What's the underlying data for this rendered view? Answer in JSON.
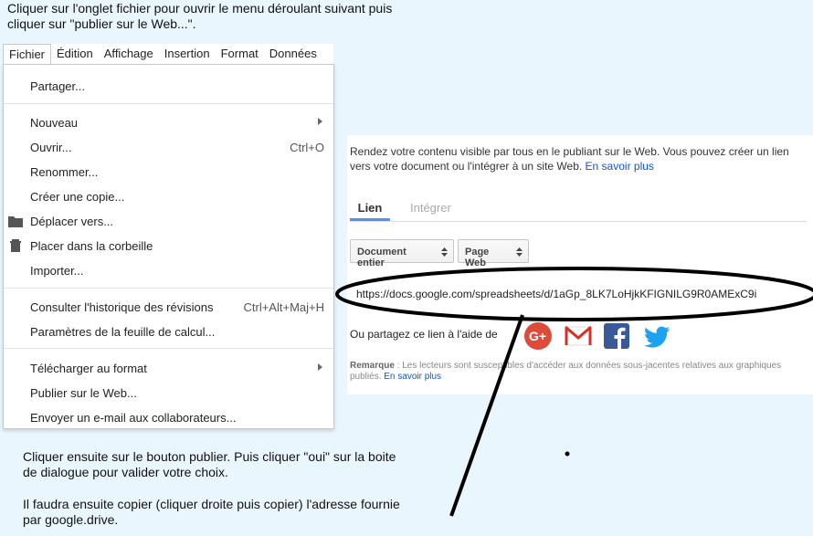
{
  "instructions": {
    "top_line1": "Cliquer sur l'onglet fichier pour ouvrir le menu déroulant suivant puis",
    "top_line2": "cliquer sur \"publier sur le Web...\".",
    "bottom_p1_line1": "Cliquer ensuite sur le bouton publier. Puis cliquer \"oui\" sur la boite",
    "bottom_p1_line2": "de dialogue pour valider votre choix.",
    "bottom_p2_line1": "Il faudra ensuite copier (cliquer droite puis copier) l'adresse fournie",
    "bottom_p2_line2": "par google.drive."
  },
  "menubar": [
    "Fichier",
    "Édition",
    "Affichage",
    "Insertion",
    "Format",
    "Données"
  ],
  "file_menu": {
    "share": "Partager...",
    "new": "Nouveau",
    "open": "Ouvrir...",
    "open_shortcut": "Ctrl+O",
    "rename": "Renommer...",
    "copy": "Créer une copie...",
    "move": "Déplacer vers...",
    "trash": "Placer dans la corbeille",
    "import": "Importer...",
    "history": "Consulter l'historique des révisions",
    "history_shortcut": "Ctrl+Alt+Maj+H",
    "settings": "Paramètres de la feuille de calcul...",
    "download": "Télécharger au format",
    "publish": "Publier sur le Web...",
    "email": "Envoyer un e-mail aux collaborateurs..."
  },
  "publish_panel": {
    "description": "Rendez votre contenu visible par tous en le publiant sur le Web. Vous pouvez créer un lien vers votre document ou l'intégrer à un site Web.",
    "learn_more": "En savoir plus",
    "tab_link": "Lien",
    "tab_embed": "Intégrer",
    "select_document": "Document entier",
    "select_format": "Page Web",
    "url": "https://docs.google.com/spreadsheets/d/1aGp_8LK7LoHjkKFIGNILG9R0AMExC9i",
    "share_label": "Ou partagez ce lien à l'aide de",
    "note_label": "Remarque",
    "note_text": " : Les lecteurs sont susceptibles d'accéder aux données sous-jacentes relatives aux graphiques publiés.",
    "note_learn_more": "En savoir plus"
  },
  "social_icons": [
    "google-plus-icon",
    "gmail-icon",
    "facebook-icon",
    "twitter-icon"
  ],
  "colors": {
    "background": "#eaf6fd",
    "accent_blue": "#4d90fe",
    "link": "#1155cc",
    "google_plus": "#dd4b39",
    "facebook": "#3b5998",
    "twitter": "#1da1f2"
  }
}
